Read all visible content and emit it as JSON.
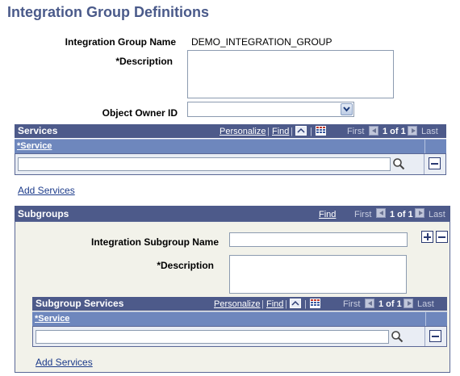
{
  "page": {
    "title": "Integration Group Definitions"
  },
  "form": {
    "group_name_label": "Integration Group Name",
    "group_name_value": "DEMO_INTEGRATION_GROUP",
    "description_label": "*Description",
    "description_value": "",
    "owner_label": "Object Owner ID",
    "owner_value": ""
  },
  "services_grid": {
    "title": "Services",
    "personalize": "Personalize",
    "find": "Find",
    "sep": "|",
    "first": "First",
    "range": "1 of 1",
    "last": "Last",
    "column": "*Service",
    "service_value": "",
    "add_link": "Add Services"
  },
  "subgroups": {
    "title": "Subgroups",
    "find": "Find",
    "first": "First",
    "range": "1 of 1",
    "last": "Last",
    "subgroup_name_label": "Integration Subgroup Name",
    "subgroup_name_value": "",
    "description_label": "*Description",
    "description_value": "",
    "add_glyph": "+",
    "services_grid": {
      "title": "Subgroup Services",
      "personalize": "Personalize",
      "find": "Find",
      "sep": "|",
      "first": "First",
      "range": "1 of 1",
      "last": "Last",
      "column": "*Service",
      "service_value": "",
      "add_link": "Add Services"
    }
  },
  "icons": {
    "lookup": "magnifier-icon",
    "delete": "minus-icon",
    "add": "plus-icon",
    "view_all": "view-all-icon",
    "download": "download-grid-icon",
    "dropdown": "chevron-down-icon"
  }
}
